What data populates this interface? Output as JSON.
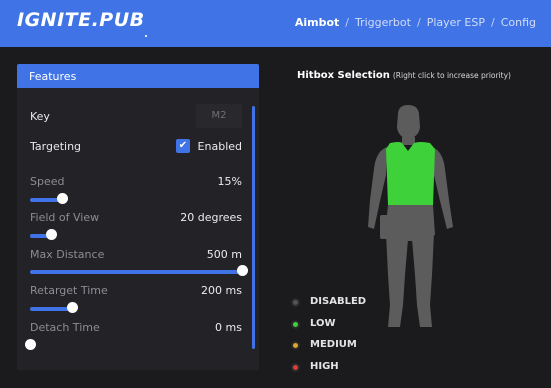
{
  "header": {
    "logo_main": "IGNITE",
    "logo_sep": ".",
    "logo_suffix": "PUB",
    "tabs": [
      {
        "label": "Aimbot",
        "active": true
      },
      {
        "label": "Triggerbot",
        "active": false
      },
      {
        "label": "Player ESP",
        "active": false
      },
      {
        "label": "Config",
        "active": false
      }
    ],
    "separator": "/"
  },
  "features": {
    "title": "Features",
    "key": {
      "label": "Key",
      "value": "M2"
    },
    "targeting": {
      "label": "Targeting",
      "checked": true,
      "value": "Enabled"
    },
    "speed": {
      "label": "Speed",
      "value": "15%",
      "fraction": 0.15
    },
    "fov": {
      "label": "Field of View",
      "value": "20 degrees",
      "fraction": 0.1
    },
    "max_distance": {
      "label": "Max Distance",
      "value": "500 m",
      "fraction": 1.0
    },
    "retarget_time": {
      "label": "Retarget Time",
      "value": "200 ms",
      "fraction": 0.2
    },
    "detach_time": {
      "label": "Detach Time",
      "value": "0 ms",
      "fraction": 0.0
    }
  },
  "hitbox": {
    "title": "Hitbox Selection",
    "note": "(Right click to increase priority)",
    "selected_region": "torso",
    "legend": [
      {
        "label": "DISABLED",
        "color": "#555555"
      },
      {
        "label": "LOW",
        "color": "#3fd13a"
      },
      {
        "label": "MEDIUM",
        "color": "#e2a52b"
      },
      {
        "label": "HIGH",
        "color": "#e03a3a"
      }
    ]
  },
  "colors": {
    "accent": "#3f73e6",
    "background": "#1b1b1e",
    "panel": "#232327",
    "body_disabled": "#5c5c5c",
    "body_low": "#3fd13a"
  }
}
